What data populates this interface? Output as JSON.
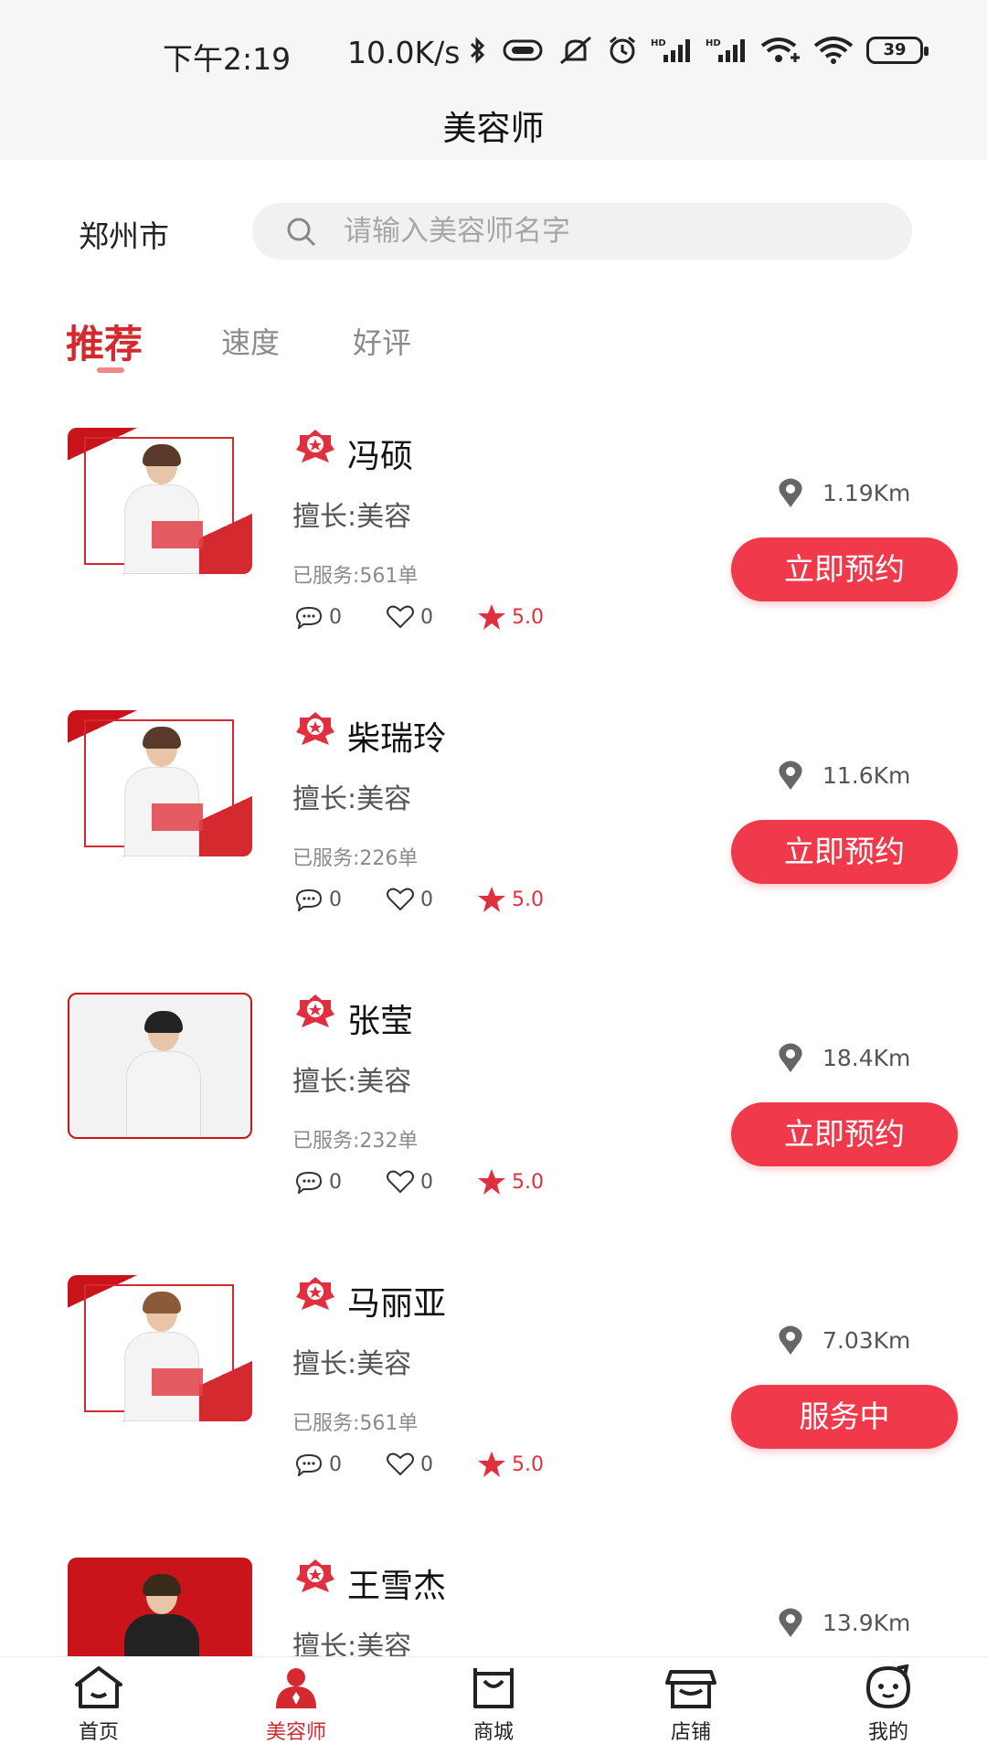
{
  "status_bar": {
    "time": "下午2:19",
    "speed": "10.0K/s",
    "battery": "39"
  },
  "app_bar": {
    "title": "美容师"
  },
  "filter": {
    "city": "郑州市",
    "search_placeholder": "请输入美容师名字"
  },
  "tabs": [
    {
      "label": "推荐",
      "active": true
    },
    {
      "label": "速度",
      "active": false
    },
    {
      "label": "好评",
      "active": false
    }
  ],
  "beauticians": [
    {
      "name": "冯硕",
      "skill": "擅长:美容",
      "served": "已服务:561单",
      "comments": "0",
      "likes": "0",
      "rating": "5.0",
      "distance": "1.19Km",
      "action": "立即预约"
    },
    {
      "name": "柴瑞玲",
      "skill": "擅长:美容",
      "served": "已服务:226单",
      "comments": "0",
      "likes": "0",
      "rating": "5.0",
      "distance": "11.6Km",
      "action": "立即预约"
    },
    {
      "name": "张莹",
      "skill": "擅长:美容",
      "served": "已服务:232单",
      "comments": "0",
      "likes": "0",
      "rating": "5.0",
      "distance": "18.4Km",
      "action": "立即预约"
    },
    {
      "name": "马丽亚",
      "skill": "擅长:美容",
      "served": "已服务:561单",
      "comments": "0",
      "likes": "0",
      "rating": "5.0",
      "distance": "7.03Km",
      "action": "服务中"
    },
    {
      "name": "王雪杰",
      "skill": "擅长:美容",
      "distance": "13.9Km"
    }
  ],
  "bottom_nav": [
    {
      "label": "首页",
      "icon": "home-icon",
      "active": false
    },
    {
      "label": "美容师",
      "icon": "beautician-icon",
      "active": true
    },
    {
      "label": "商城",
      "icon": "shopping-bag-icon",
      "active": false
    },
    {
      "label": "店铺",
      "icon": "store-icon",
      "active": false
    },
    {
      "label": "我的",
      "icon": "profile-face-icon",
      "active": false
    }
  ],
  "colors": {
    "accent": "#d42a2f",
    "button": "#f0394a",
    "rating": "#e03040"
  }
}
